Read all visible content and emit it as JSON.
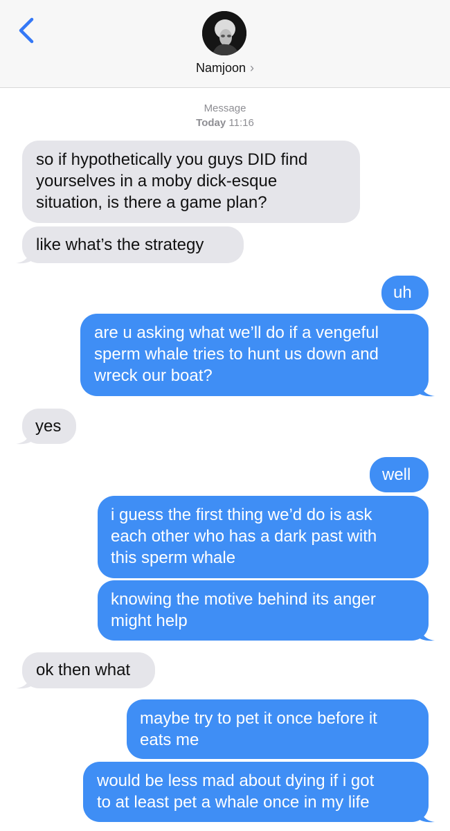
{
  "header": {
    "contact_name": "Namjoon",
    "chevron": "›",
    "back_icon": "chevron-left-icon",
    "accent": "#3478f6"
  },
  "timestamp": {
    "service": "Message",
    "day": "Today",
    "time": "11:16"
  },
  "colors": {
    "received_bg": "#e5e5ea",
    "sent_bg": "#3f8ef5",
    "sent_text": "#ffffff",
    "received_text": "#111111"
  },
  "messages": [
    {
      "from": "them",
      "lines": [
        "so if hypothetically you guys DID find",
        "yourselves in a moby dick-esque",
        "situation, is there a game plan?"
      ]
    },
    {
      "from": "them",
      "lines": [
        "like what’s the strategy"
      ]
    },
    {
      "from": "me",
      "lines": [
        "uh"
      ]
    },
    {
      "from": "me",
      "lines": [
        "are u asking what we’ll do if a vengeful",
        "sperm whale tries to hunt us down and",
        "wreck our boat?"
      ]
    },
    {
      "from": "them",
      "lines": [
        "yes"
      ]
    },
    {
      "from": "me",
      "lines": [
        "well"
      ]
    },
    {
      "from": "me",
      "lines": [
        "i guess the first thing we’d do is ask",
        "each other who has a dark past with",
        "this sperm whale"
      ]
    },
    {
      "from": "me",
      "lines": [
        "knowing the motive behind its anger",
        "might help"
      ]
    },
    {
      "from": "them",
      "lines": [
        "ok then what"
      ]
    },
    {
      "from": "me",
      "lines": [
        "maybe try to pet it once before it",
        "eats me"
      ]
    },
    {
      "from": "me",
      "lines": [
        "would be less mad about dying if i got",
        "to at least pet a whale once in my life"
      ]
    }
  ]
}
